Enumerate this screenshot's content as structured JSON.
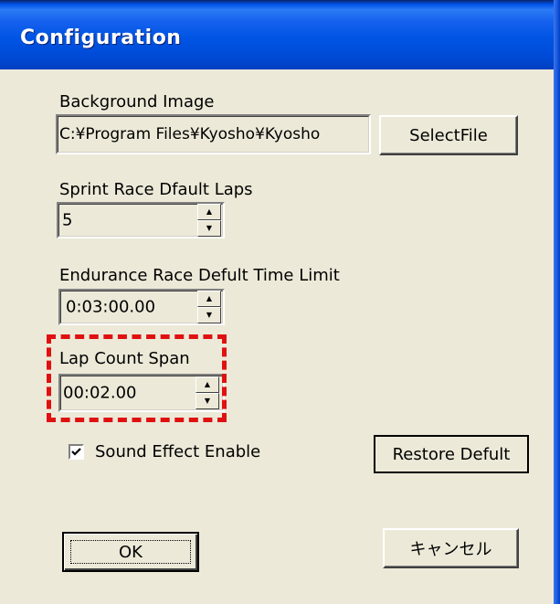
{
  "window": {
    "title": "Configuration"
  },
  "background_image": {
    "label": "Background Image",
    "value": "C:¥Program Files¥Kyosho¥Kyosho",
    "select_button": "SelectFile"
  },
  "sprint": {
    "label": "Sprint Race Dfault Laps",
    "value": "5"
  },
  "endurance": {
    "label": "Endurance Race Defult Time Limit",
    "value": "0:03:00.00"
  },
  "lap_count": {
    "label": "Lap Count Span",
    "value": "00:02.00"
  },
  "sound": {
    "label": "Sound Effect Enable",
    "checked": true
  },
  "buttons": {
    "restore": "Restore Defult",
    "ok": "OK",
    "cancel": "キャンセル"
  },
  "colors": {
    "highlight": "#e01010",
    "titlebar": "#0054e3",
    "dialog_bg": "#ece9d8"
  },
  "icons": {
    "spin_up": "spin-up-arrow-icon",
    "spin_down": "spin-down-arrow-icon",
    "checkmark": "checkmark-icon"
  }
}
